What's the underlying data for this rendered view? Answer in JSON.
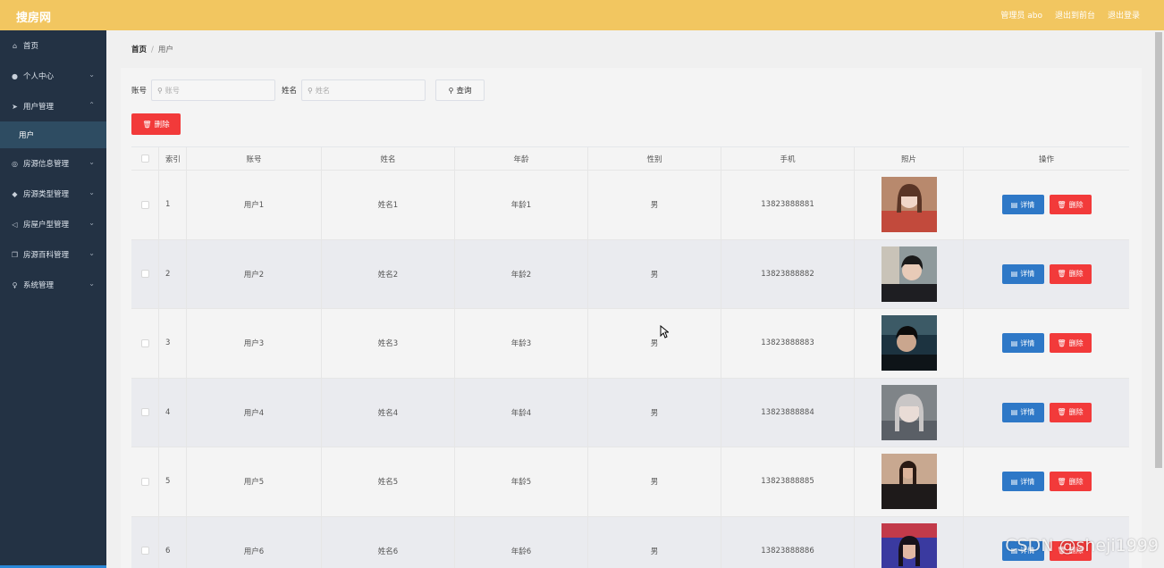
{
  "header": {
    "title": "搜房网",
    "admin_label": "管理员 abo",
    "to_front": "退出到前台",
    "logout": "退出登录"
  },
  "sidebar": {
    "items": [
      {
        "label": "首页",
        "icon": "home-icon"
      },
      {
        "label": "个人中心",
        "icon": "user-icon"
      },
      {
        "label": "用户管理",
        "icon": "paper-plane-icon"
      },
      {
        "label": "用户"
      },
      {
        "label": "房源信息管理",
        "icon": "globe-icon"
      },
      {
        "label": "房源类型管理",
        "icon": "location-pin-icon"
      },
      {
        "label": "房屋户型管理",
        "icon": "navigation-icon"
      },
      {
        "label": "房源百科管理",
        "icon": "copy-icon"
      },
      {
        "label": "系统管理",
        "icon": "microphone-icon"
      }
    ]
  },
  "breadcrumb": {
    "home": "首页",
    "current": "用户"
  },
  "search": {
    "account_label": "账号",
    "account_placeholder": "账号",
    "name_label": "姓名",
    "name_placeholder": "姓名",
    "query_button": "查询"
  },
  "toolbar": {
    "delete_label": "删除"
  },
  "table": {
    "headers": [
      "索引",
      "账号",
      "姓名",
      "年龄",
      "性别",
      "手机",
      "照片",
      "操作"
    ],
    "rows": [
      {
        "index": "1",
        "account": "用户1",
        "name": "姓名1",
        "age": "年龄1",
        "gender": "男",
        "phone": "13823888881"
      },
      {
        "index": "2",
        "account": "用户2",
        "name": "姓名2",
        "age": "年龄2",
        "gender": "男",
        "phone": "13823888882"
      },
      {
        "index": "3",
        "account": "用户3",
        "name": "姓名3",
        "age": "年龄3",
        "gender": "男",
        "phone": "13823888883"
      },
      {
        "index": "4",
        "account": "用户4",
        "name": "姓名4",
        "age": "年龄4",
        "gender": "男",
        "phone": "13823888884"
      },
      {
        "index": "5",
        "account": "用户5",
        "name": "姓名5",
        "age": "年龄5",
        "gender": "男",
        "phone": "13823888885"
      },
      {
        "index": "6",
        "account": "用户6",
        "name": "姓名6",
        "age": "年龄6",
        "gender": "男",
        "phone": "13823888886"
      }
    ],
    "detail_label": "详情",
    "delete_label": "删除"
  },
  "watermark": "CSDN @sheji1999",
  "colors": {
    "header": "#f2c660",
    "sidebar": "#233244",
    "active_submenu": "#2e4c62",
    "primary": "#2e78c7",
    "danger": "#f23a3a"
  }
}
